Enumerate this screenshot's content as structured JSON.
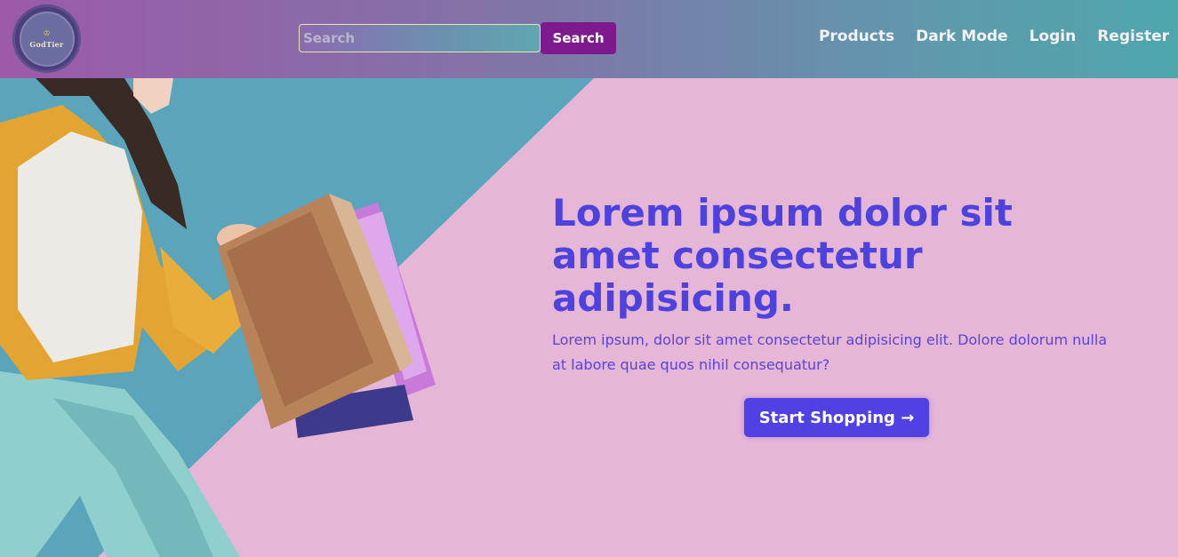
{
  "header": {
    "logo_text": "GodTier",
    "search": {
      "placeholder": "Search",
      "value": ""
    },
    "search_button": "Search",
    "nav": [
      "Products",
      "Dark Mode",
      "Login",
      "Register"
    ]
  },
  "hero": {
    "title": "Lorem ipsum dolor sit amet consectetur adipisicing.",
    "text": "Lorem ipsum, dolor sit amet consectetur adipisicing elit. Dolore dolorum nulla at labore quae quos nihil consequatur?",
    "cta": "Start Shopping →"
  },
  "colors": {
    "accent": "#4f41e3",
    "search_button": "#7d1a8e",
    "hero_pink": "#e6b6d6",
    "hero_teal": "#5aa5bb"
  }
}
